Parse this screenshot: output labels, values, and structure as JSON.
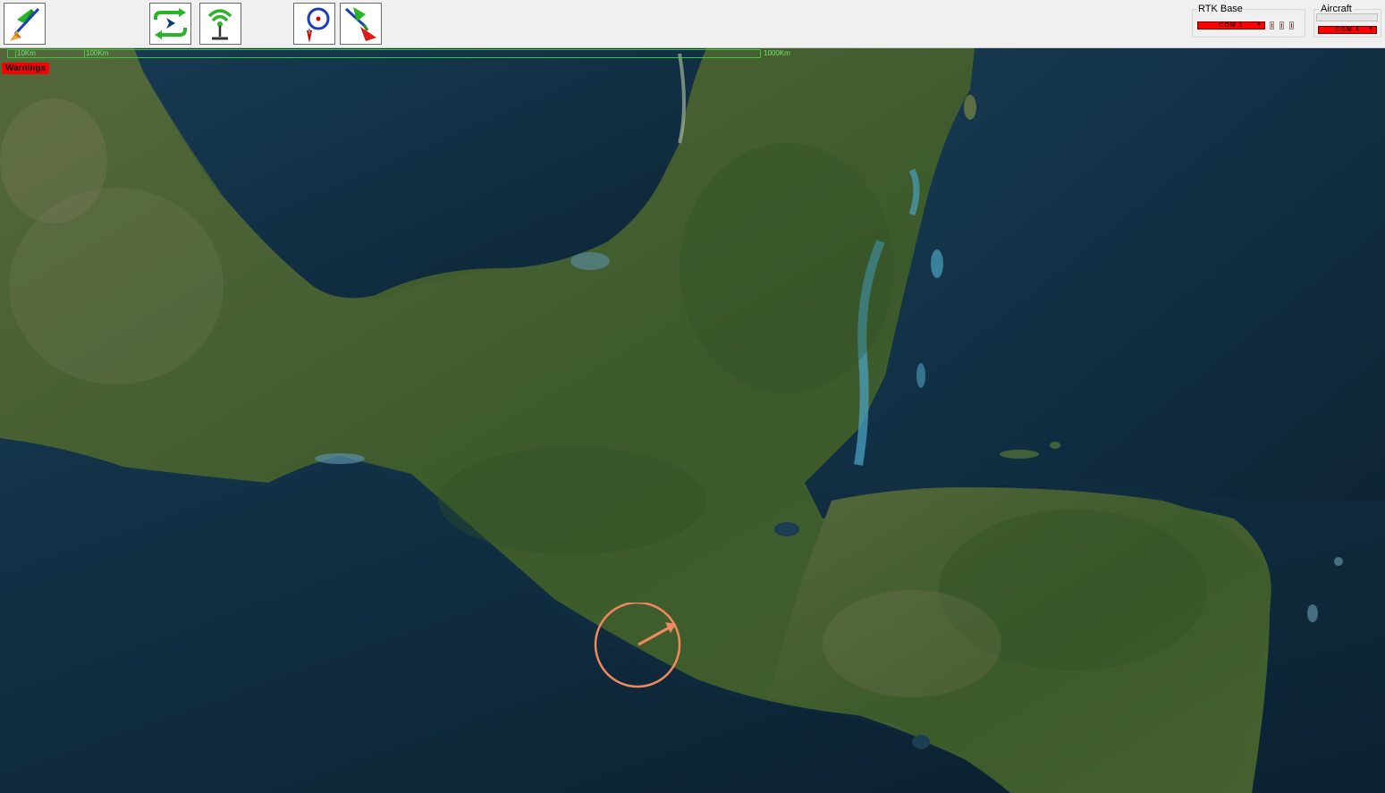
{
  "toolbar": {
    "buttons": [
      {
        "name": "connect-aircraft",
        "icon": "aircraft-connect-icon"
      },
      {
        "name": "flight-plan-loop",
        "icon": "flight-loop-icon"
      },
      {
        "name": "rtk-base-station",
        "icon": "antenna-tower-icon"
      },
      {
        "name": "target-point",
        "icon": "target-pin-icon"
      },
      {
        "name": "return-aircraft",
        "icon": "aircraft-return-icon"
      }
    ],
    "rtk_base": {
      "label": "RTK Base",
      "com_port": "COM 1",
      "indicators": 3
    },
    "aircraft": {
      "label": "Aircraft",
      "com_port": "COM 4"
    }
  },
  "map": {
    "scale": {
      "labels": [
        "10Km",
        "100Km",
        "1000Km"
      ]
    },
    "warnings_label": "Warnings",
    "aircraft_marker": "aircraft-position-icon"
  },
  "colors": {
    "status_error": "#ff0000",
    "scale_green": "#37c837",
    "ocean_deep": "#0f2b3e",
    "land_green": "#3b5a2a",
    "aircraft_marker": "#f08a5e"
  }
}
